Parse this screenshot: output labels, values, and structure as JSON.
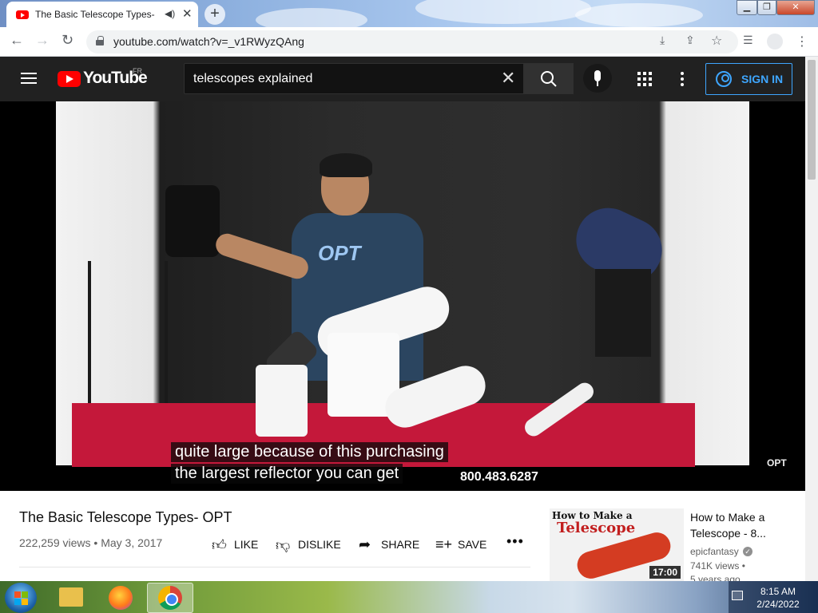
{
  "browser": {
    "tab_title": "The Basic Telescope Types- OPT",
    "url": "youtube.com/watch?v=_v1RWyzQAng",
    "new_tab_symbol": "+",
    "tab_close_symbol": "✕"
  },
  "youtube": {
    "logo_text": "YouTube",
    "country_code": "FR",
    "search_value": "telescopes explained",
    "sign_in_label": "SIGN IN"
  },
  "video": {
    "subtitle_line1": "quite large because of this purchasing",
    "subtitle_line2": "the largest reflector you can get",
    "phone_number": "800.483.6287",
    "watermark": "OPT",
    "shirt_logo": "OPT"
  },
  "details": {
    "title": "The Basic Telescope Types- OPT",
    "views": "222,259 views",
    "separator": "•",
    "date": "May 3, 2017",
    "actions": {
      "like": "LIKE",
      "dislike": "DISLIKE",
      "share": "SHARE",
      "save": "SAVE"
    }
  },
  "recommended": {
    "thumb_line1": "How to Make a",
    "thumb_line2": "Telescope",
    "duration": "17:00",
    "title": "How to Make a Telescope - 8...",
    "channel": "epicfantasy",
    "views": "741K views •",
    "age": "5 years ago"
  },
  "taskbar": {
    "time": "8:15 AM",
    "date": "2/24/2022"
  },
  "icons": {
    "youtube_favicon": "youtube-favicon",
    "audio": "speaker-icon",
    "back": "back-arrow-icon",
    "forward": "forward-arrow-icon",
    "reload": "reload-icon",
    "lock": "lock-icon",
    "install": "install-icon",
    "share": "share-icon",
    "bookmark": "star-icon",
    "reading_list": "reading-list-icon",
    "profile": "profile-icon",
    "menu": "kebab-menu-icon"
  },
  "colors": {
    "youtube_red": "#ff0000",
    "yt_header": "#212121",
    "sign_in_blue": "#3ea6ff"
  }
}
